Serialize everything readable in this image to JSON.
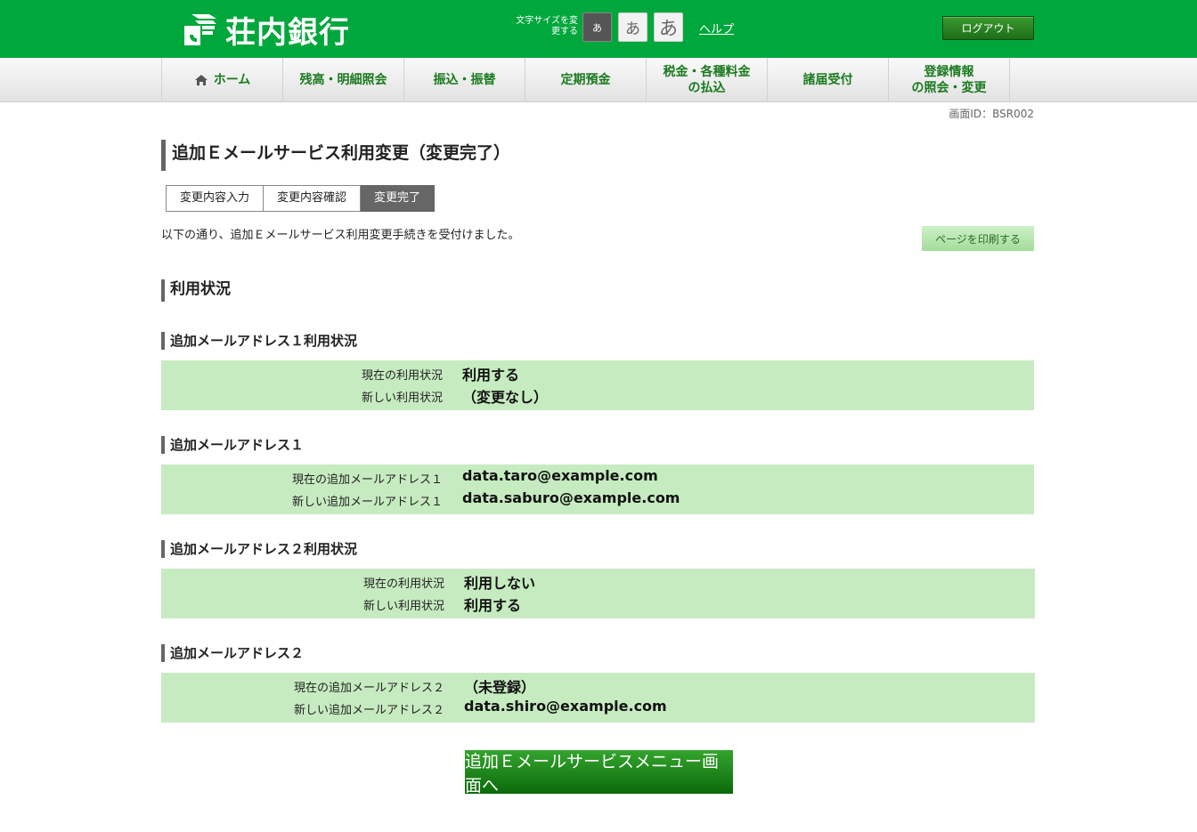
{
  "header": {
    "bank_name": "荘内銀行",
    "fontsize_label": "文字サイズを変更する",
    "fontsize_small": "あ",
    "fontsize_medium": "あ",
    "fontsize_large": "あ",
    "help_label": "ヘルプ",
    "logout_label": "ログアウト"
  },
  "nav": {
    "home": "ホーム",
    "balance": "残高・明細照会",
    "transfer": "振込・振替",
    "time_deposit": "定期預金",
    "tax_line1": "税金・各種料金",
    "tax_line2": "の払込",
    "applications": "諸届受付",
    "registration_line1": "登録情報",
    "registration_line2": "の照会・変更"
  },
  "screen_id": "画面ID：BSR002",
  "page_title": "追加Ｅメールサービス利用変更（変更完了）",
  "steps": [
    "変更内容入力",
    "変更内容確認",
    "変更完了"
  ],
  "intro_text": "以下の通り、追加Ｅメールサービス利用変更手続きを受付けました。",
  "print_label": "ページを印刷する",
  "section_title": "利用状況",
  "blocks": [
    {
      "title": "追加メールアドレス１利用状況",
      "rows": [
        {
          "label": "現在の利用状況",
          "value": "利用する"
        },
        {
          "label": "新しい利用状況",
          "value": "（変更なし）"
        }
      ]
    },
    {
      "title": "追加メールアドレス１",
      "rows": [
        {
          "label": "現在の追加メールアドレス１",
          "value": "data.taro@example.com"
        },
        {
          "label": "新しい追加メールアドレス１",
          "value": "data.saburo@example.com"
        }
      ]
    },
    {
      "title": "追加メールアドレス２利用状況",
      "rows": [
        {
          "label": "現在の利用状況",
          "value": "利用しない"
        },
        {
          "label": "新しい利用状況",
          "value": "利用する"
        }
      ]
    },
    {
      "title": "追加メールアドレス２",
      "rows": [
        {
          "label": "現在の追加メールアドレス２",
          "value": "（未登録）"
        },
        {
          "label": "新しい追加メールアドレス２",
          "value": "data.shiro@example.com"
        }
      ]
    }
  ],
  "menu_button_label": "追加Ｅメールサービスメニュー画面へ",
  "colors": {
    "header_green": "#00a73c",
    "nav_text": "#1a7a1e",
    "block_bg": "#c6ebc0",
    "button_green": "#1a7e18"
  }
}
